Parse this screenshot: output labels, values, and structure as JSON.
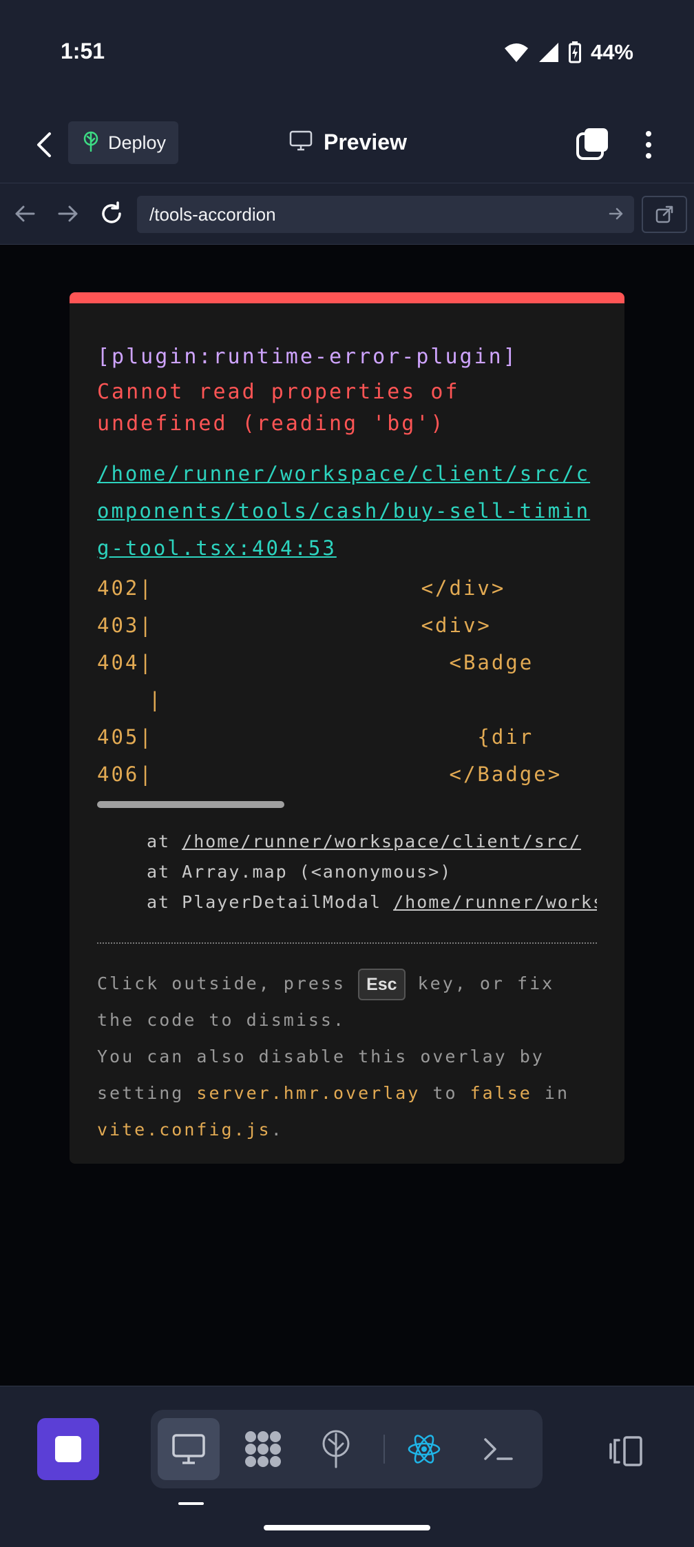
{
  "status_bar": {
    "time": "1:51",
    "battery": "44%",
    "icons": [
      "wifi-icon",
      "signal-icon",
      "battery-charging-icon"
    ]
  },
  "app_bar": {
    "deploy_label": "Deploy",
    "title": "Preview",
    "icons": [
      "back-arrow-icon",
      "deploy-tree-icon",
      "monitor-icon",
      "tabs-icon",
      "more-vertical-icon"
    ]
  },
  "url_bar": {
    "url": "/tools-accordion",
    "icons": [
      "nav-back-icon",
      "nav-forward-icon",
      "reload-icon",
      "go-arrow-icon",
      "open-external-icon"
    ]
  },
  "error_overlay": {
    "plugin": "[plugin:runtime-error-plugin]",
    "message": "Cannot read properties of undefined (reading 'bg')",
    "file": "/home/runner/workspace/client/src/components/tools/cash/buy-sell-timing-tool.tsx:404:53",
    "code_frame": [
      {
        "num": "402",
        "code": "                   </div>"
      },
      {
        "num": "403",
        "code": "                   <div>"
      },
      {
        "num": "404",
        "code": "                     <Badge"
      },
      {
        "num": "",
        "code": ""
      },
      {
        "num": "405",
        "code": "                       {dir"
      },
      {
        "num": "406",
        "code": "                     </Badge>"
      }
    ],
    "stack": [
      {
        "prefix": "at ",
        "text": "",
        "link": "/home/runner/workspace/client/src/"
      },
      {
        "prefix": "at ",
        "text": "Array.map (<anonymous>)",
        "link": ""
      },
      {
        "prefix": "at ",
        "text": "PlayerDetailModal ",
        "link": "/home/runner/workspace"
      }
    ],
    "tip": {
      "part1": "Click outside, press ",
      "key": "Esc",
      "part2": " key, or fix the code to dismiss.",
      "line2_a": "You can also disable this overlay by setting ",
      "setting": "server.hmr.overlay",
      "line2_b": " to ",
      "value": "false",
      "line2_c": " in ",
      "file": "vite.config.js",
      "line2_d": "."
    },
    "colors": {
      "accent_bar": "#ff5555",
      "plugin": "#cfa4ff",
      "message": "#ff5555",
      "file_link": "#2dd4bf",
      "code": "#e2aa53"
    }
  },
  "bottom_bar": {
    "tools": [
      "preview-monitor-icon",
      "workflows-icon",
      "deploy-icon",
      "react-icon",
      "shell-terminal-icon"
    ],
    "active_tool": "preview-monitor-icon",
    "stop_button": "stop-icon",
    "panel_button": "panel-toggle-icon",
    "accent": "#5b3fd6"
  }
}
